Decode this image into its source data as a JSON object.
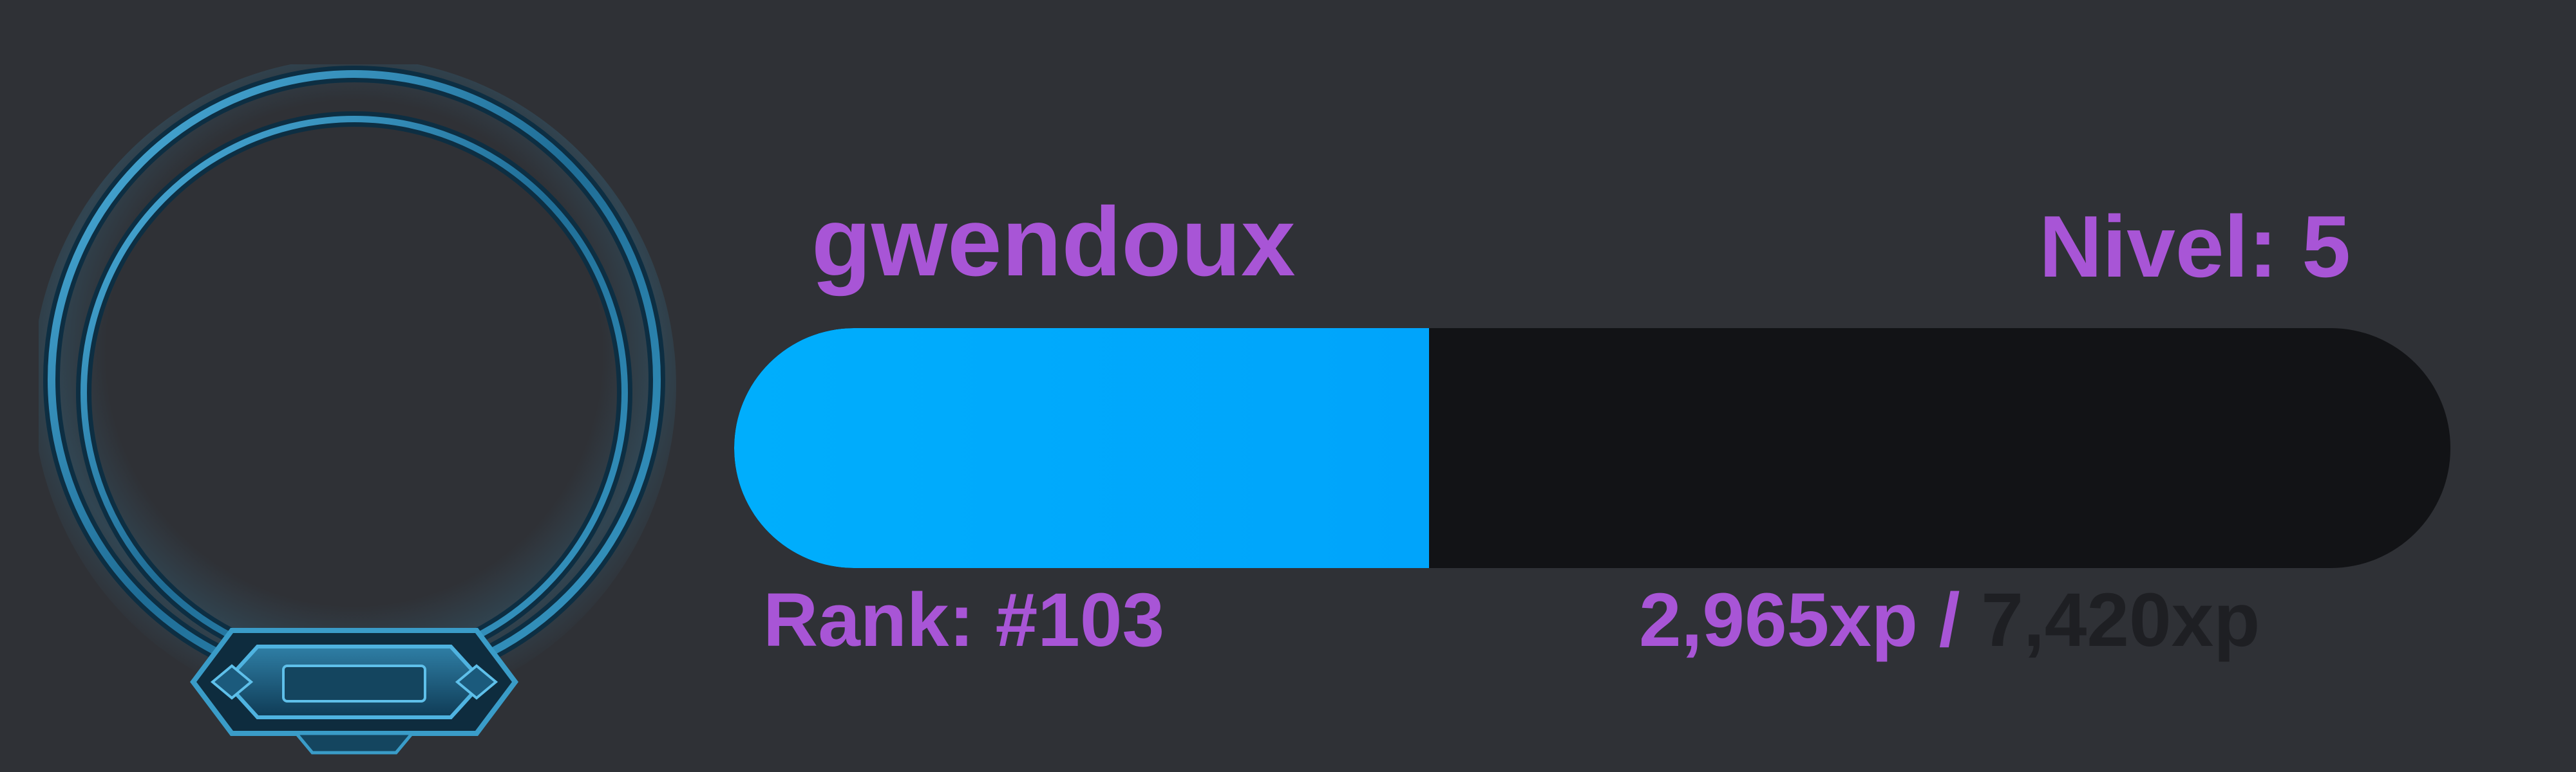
{
  "profile": {
    "username": "gwendoux",
    "level_text": "Nivel: 5",
    "rank_text": "Rank: #103"
  },
  "xp": {
    "current": "2,965xp",
    "separator": " / ",
    "total": "7,420xp",
    "progress_fraction": 0.405
  },
  "colors": {
    "background": "#2f3136",
    "accent_text": "#a855d6",
    "bar_fill": "#00aefc",
    "bar_track": "#121316",
    "frame": "#2a7fa8"
  },
  "icons": {
    "avatar_frame": "ornate-ring-frame-icon"
  }
}
